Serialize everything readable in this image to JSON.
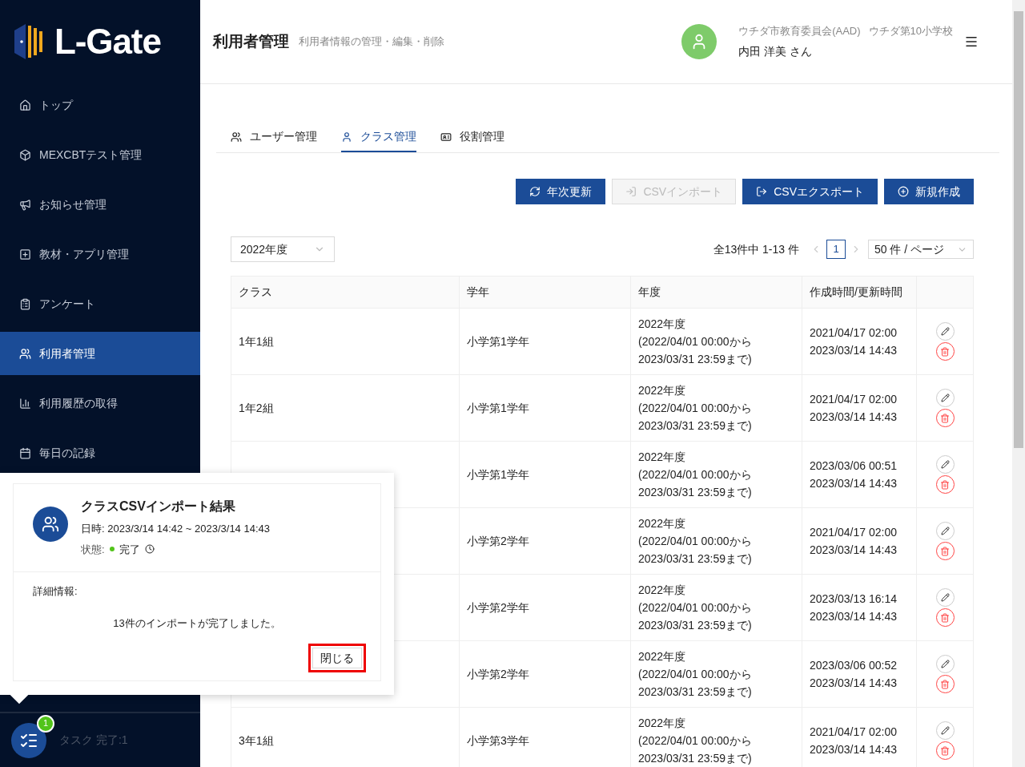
{
  "sidebar": {
    "logo": "L-Gate",
    "items": [
      {
        "label": "トップ",
        "selected": false
      },
      {
        "label": "MEXCBTテスト管理",
        "selected": false
      },
      {
        "label": "お知らせ管理",
        "selected": false
      },
      {
        "label": "教材・アプリ管理",
        "selected": false
      },
      {
        "label": "アンケート",
        "selected": false
      },
      {
        "label": "利用者管理",
        "selected": true
      },
      {
        "label": "利用履歴の取得",
        "selected": false
      },
      {
        "label": "毎日の記録",
        "selected": false
      }
    ],
    "tasks": {
      "badge": "1",
      "label": "タスク 完了:1"
    }
  },
  "header": {
    "title": "利用者管理",
    "subtitle": "利用者情報の管理・編集・削除",
    "organization": "ウチダ市教育委員会(AAD)",
    "school": "ウチダ第10小学校",
    "user": "内田 洋美 さん"
  },
  "tabs": [
    {
      "label": "ユーザー管理",
      "selected": false
    },
    {
      "label": "クラス管理",
      "selected": true
    },
    {
      "label": "役割管理",
      "selected": false
    }
  ],
  "buttons": [
    {
      "label": "年次更新",
      "disabled": false
    },
    {
      "label": "CSVインポート",
      "disabled": true
    },
    {
      "label": "CSVエクスポート",
      "disabled": false
    },
    {
      "label": "新規作成",
      "disabled": false
    }
  ],
  "year_select": "2022年度",
  "pagination": {
    "summary": "全13件中 1-13 件",
    "page": "1",
    "page_size": "50 件 / ページ"
  },
  "table": {
    "columns": [
      "クラス",
      "学年",
      "年度",
      "作成時間/更新時間"
    ],
    "rows": [
      {
        "class": "1年1組",
        "grade": "小学第1学年",
        "year": [
          "2022年度",
          "(2022/04/01 00:00から",
          "2023/03/31 23:59まで)"
        ],
        "times": [
          "2021/04/17 02:00",
          "2023/03/14 14:43"
        ]
      },
      {
        "class": "1年2組",
        "grade": "小学第1学年",
        "year": [
          "2022年度",
          "(2022/04/01 00:00から",
          "2023/03/31 23:59まで)"
        ],
        "times": [
          "2021/04/17 02:00",
          "2023/03/14 14:43"
        ]
      },
      {
        "grade": "小学第1学年",
        "year": [
          "2022年度",
          "(2022/04/01 00:00から",
          "2023/03/31 23:59まで)"
        ],
        "times": [
          "2023/03/06 00:51",
          "2023/03/14 14:43"
        ]
      },
      {
        "grade": "小学第2学年",
        "year": [
          "2022年度",
          "(2022/04/01 00:00から",
          "2023/03/31 23:59まで)"
        ],
        "times": [
          "2021/04/17 02:00",
          "2023/03/14 14:43"
        ]
      },
      {
        "grade": "小学第2学年",
        "year": [
          "2022年度",
          "(2022/04/01 00:00から",
          "2023/03/31 23:59まで)"
        ],
        "times": [
          "2023/03/13 16:14",
          "2023/03/14 14:43"
        ]
      },
      {
        "grade": "小学第2学年",
        "year": [
          "2022年度",
          "(2022/04/01 00:00から",
          "2023/03/31 23:59まで)"
        ],
        "times": [
          "2023/03/06 00:52",
          "2023/03/14 14:43"
        ]
      },
      {
        "class": "3年1組",
        "grade": "小学第3学年",
        "year": [
          "2022年度",
          "(2022/04/01 00:00から",
          "2023/03/31 23:59まで)"
        ],
        "times": [
          "2021/04/17 02:00",
          "2023/03/14 14:43"
        ]
      }
    ]
  },
  "popup": {
    "title": "クラスCSVインポート結果",
    "datetime": "日時: 2023/3/14 14:42 ~ 2023/3/14 14:43",
    "status_label": "状態:",
    "status": "完了",
    "details_label": "詳細情報:",
    "message": "13件のインポートが完了しました。",
    "close_button": "閉じる"
  }
}
